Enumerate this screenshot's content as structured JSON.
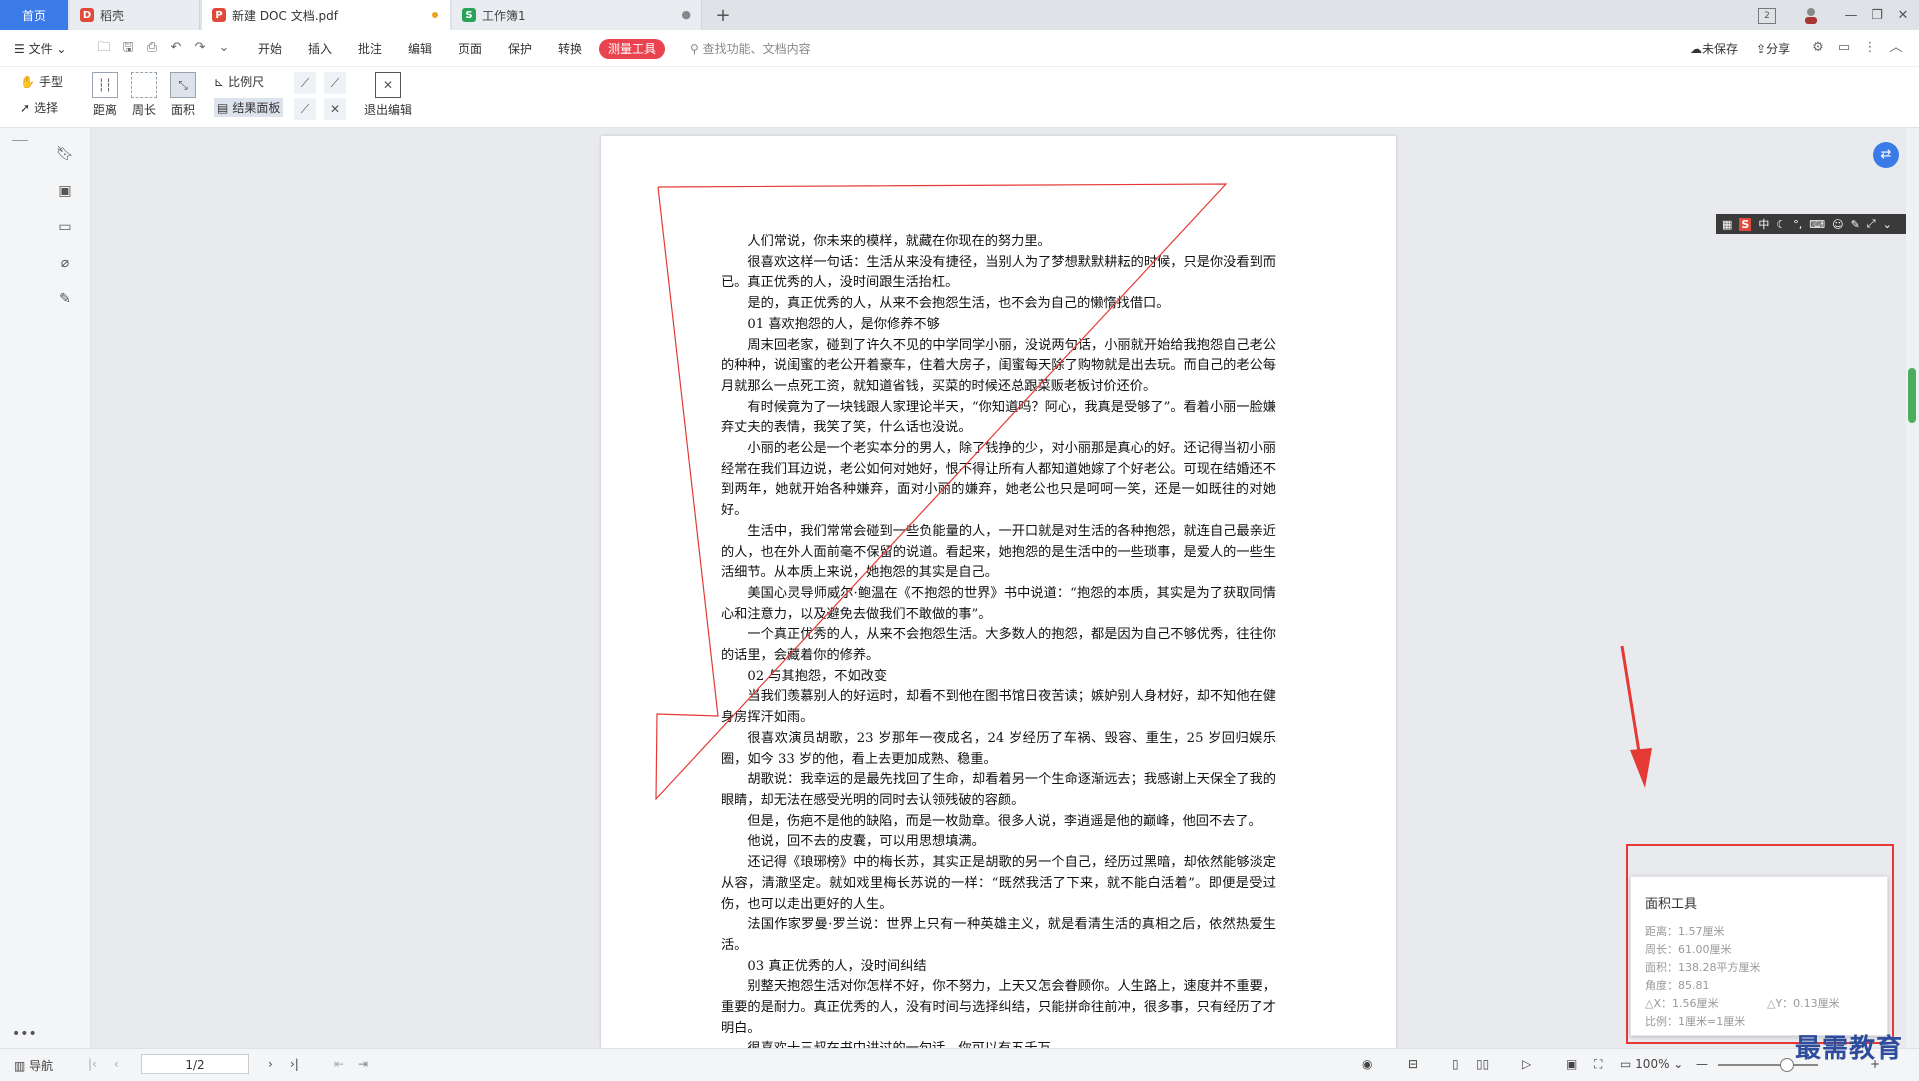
{
  "tabs": {
    "home": "首页",
    "daoke": "稻壳",
    "pdf_doc": "新建 DOC 文档.pdf",
    "workbook": "工作簿1"
  },
  "window": {
    "page_count_badge": "2"
  },
  "menu": {
    "file": "文件",
    "items": [
      "开始",
      "插入",
      "批注",
      "编辑",
      "页面",
      "保护",
      "转换"
    ],
    "measure_tool": "测量工具",
    "search_placeholder": "查找功能、文档内容",
    "unsaved": "未保存",
    "share": "分享"
  },
  "toolbar": {
    "hand": "手型",
    "select": "选择",
    "distance": "距离",
    "perimeter": "周长",
    "area": "面积",
    "scale": "比例尺",
    "result_panel": "结果面板",
    "exit_edit": "退出编辑"
  },
  "document": {
    "paragraphs": [
      "人们常说，你未来的模样，就藏在你现在的努力里。",
      "很喜欢这样一句话：生活从来没有捷径，当别人为了梦想默默耕耘的时候，只是你没看到而已。真正优秀的人，没时间跟生活抬杠。",
      "是的，真正优秀的人，从来不会抱怨生活，也不会为自己的懒惰找借口。",
      "01 喜欢抱怨的人，是你修养不够",
      "周末回老家，碰到了许久不见的中学同学小丽，没说两句话，小丽就开始给我抱怨自己老公的种种，说闺蜜的老公开着豪车，住着大房子，闺蜜每天除了购物就是出去玩。而自己的老公每月就那么一点死工资，就知道省钱，买菜的时候还总跟菜贩老板讨价还价。",
      "有时候竟为了一块钱跟人家理论半天，“你知道吗？阿心，我真是受够了”。看着小丽一脸嫌弃丈夫的表情，我笑了笑，什么话也没说。",
      "小丽的老公是一个老实本分的男人，除了钱挣的少，对小丽那是真心的好。还记得当初小丽经常在我们耳边说，老公如何对她好，恨不得让所有人都知道她嫁了个好老公。可现在结婚还不到两年，她就开始各种嫌弃，面对小丽的嫌弃，她老公也只是呵呵一笑，还是一如既往的对她好。",
      "生活中，我们常常会碰到一些负能量的人，一开口就是对生活的各种抱怨，就连自己最亲近的人，也在外人面前毫不保留的说道。看起来，她抱怨的是生活中的一些琐事，是爱人的一些生活细节。从本质上来说，她抱怨的其实是自己。",
      "美国心灵导师威尔·鲍温在《不抱怨的世界》书中说道：“抱怨的本质，其实是为了获取同情心和注意力，以及避免去做我们不敢做的事”。",
      "一个真正优秀的人，从来不会抱怨生活。大多数人的抱怨，都是因为自己不够优秀，往往你的话里，会藏着你的修养。",
      "02 与其抱怨，不如改变",
      "当我们羡慕别人的好运时，却看不到他在图书馆日夜苦读；嫉妒别人身材好，却不知他在健身房挥汗如雨。",
      "很喜欢演员胡歌，23 岁那年一夜成名，24 岁经历了车祸、毁容、重生，25 岁回归娱乐圈，如今 33 岁的他，看上去更加成熟、稳重。",
      "胡歌说：我幸运的是最先找回了生命，却看着另一个生命逐渐远去；我感谢上天保全了我的眼睛，却无法在感受光明的同时去认领残破的容颜。",
      "但是，伤疤不是他的缺陷，而是一枚勋章。很多人说，李逍遥是他的巅峰，他回不去了。",
      "他说，回不去的皮囊，可以用思想填满。",
      "还记得《琅琊榜》中的梅长苏，其实正是胡歌的另一个自己，经历过黑暗，却依然能够淡定从容，清澈坚定。就如戏里梅长苏说的一样：“既然我活了下来，就不能白活着”。即便是受过伤，也可以走出更好的人生。",
      "法国作家罗曼·罗兰说：世界上只有一种英雄主义，就是看清生活的真相之后，依然热爱生活。",
      "03 真正优秀的人，没时间纠结",
      "别整天抱怨生活对你怎样不好，你不努力，上天又怎会眷顾你。人生路上，速度并不重要，重要的是耐力。真正优秀的人，没有时间与选择纠结，只能拼命往前冲，很多事，只有经历了才明白。",
      "很喜欢十三叔在书中讲过的一句话，你可以有五千万..."
    ]
  },
  "panel": {
    "title": "面积工具",
    "height": "距离：1.57厘米",
    "perimeter": "周长：61.00厘米",
    "area": "面积：138.28平方厘米",
    "angle": "角度：85.81",
    "dx": "△X：1.56厘米",
    "dy": "△Y：0.13厘米",
    "scale": "比例：1厘米=1厘米"
  },
  "ime": {
    "mode": "中"
  },
  "status": {
    "nav": "导航",
    "page": "1/2",
    "zoom": "100%"
  },
  "watermark": "最需教育",
  "colors": {
    "accent_red": "#e8434f",
    "annotation_red": "#e53935",
    "home_blue": "#3b7be8"
  }
}
